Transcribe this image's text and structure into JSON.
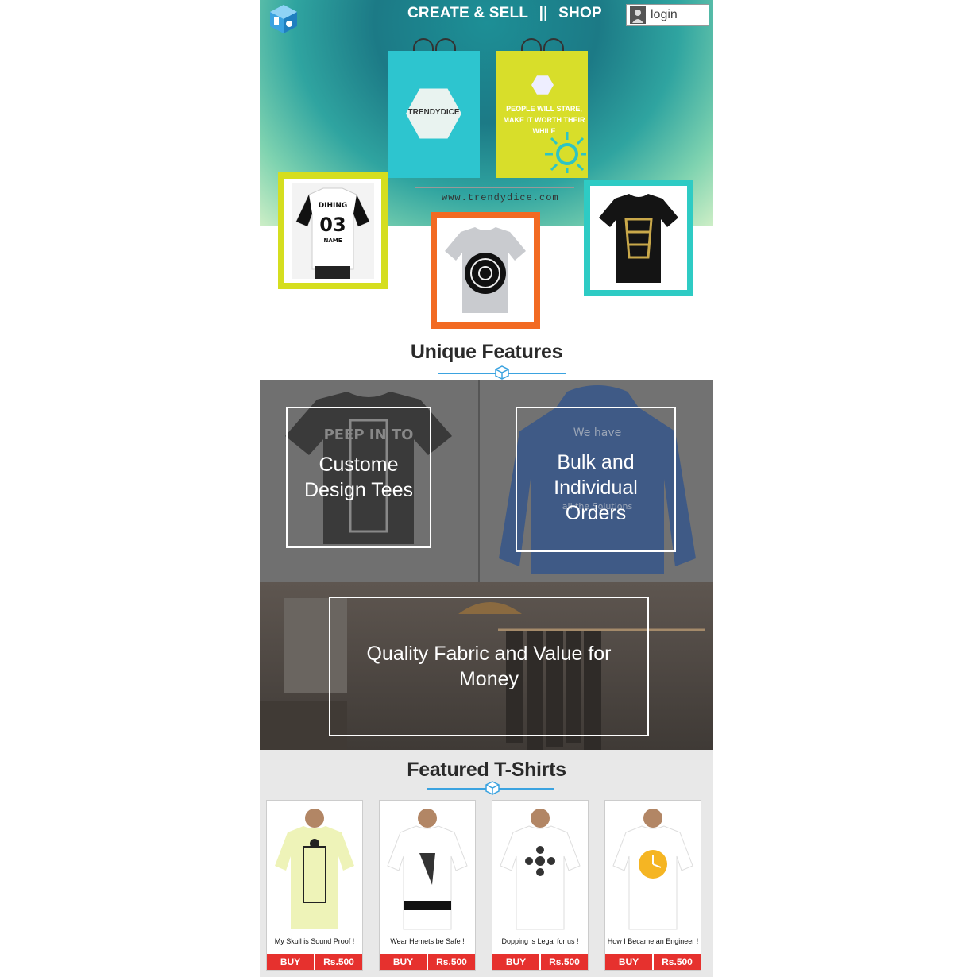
{
  "header": {
    "nav_create_sell": "CREATE & SELL",
    "nav_separator": "||",
    "nav_shop": "SHOP",
    "login_label": "login"
  },
  "hero": {
    "bag1_brand": "TRENDYDICE",
    "bag2_tagline_1": "PEOPLE WILL STARE,",
    "bag2_tagline_2": "MAKE IT WORTH THEIR WHILE",
    "url": "www.trendydice.com",
    "tee1_text_1": "DIHING",
    "tee1_text_2": "03",
    "tee1_text_3": "NAME"
  },
  "features": {
    "title": "Unique Features",
    "tile1_label": "Custome Design Tees",
    "tile2_label": "Bulk and Individual Orders",
    "tile2_bg_top": "We have",
    "tile2_bg_bottom": "all the Solutions",
    "tile1_bg_text": "PEEP IN TO",
    "tile3_label": "Quality Fabric and Value for Money"
  },
  "featured": {
    "title": "Featured T-Shirts",
    "products": [
      {
        "name": "My Skull is Sound Proof !",
        "buy": "BUY",
        "price": "Rs.500",
        "tee_color": "#eef3b8"
      },
      {
        "name": "Wear Hemets be Safe !",
        "buy": "BUY",
        "price": "Rs.500",
        "tee_color": "#ffffff"
      },
      {
        "name": "Dopping is Legal for us !",
        "buy": "BUY",
        "price": "Rs.500",
        "tee_color": "#ffffff"
      },
      {
        "name": "How I Became an Engineer !",
        "buy": "BUY",
        "price": "Rs.500",
        "tee_color": "#ffffff"
      }
    ]
  },
  "colors": {
    "accent_blue": "#3ba3e0",
    "buy_red": "#e6312e",
    "frame_yellow": "#d5de1f",
    "frame_orange": "#f26a22",
    "frame_teal": "#2ecbc4"
  }
}
